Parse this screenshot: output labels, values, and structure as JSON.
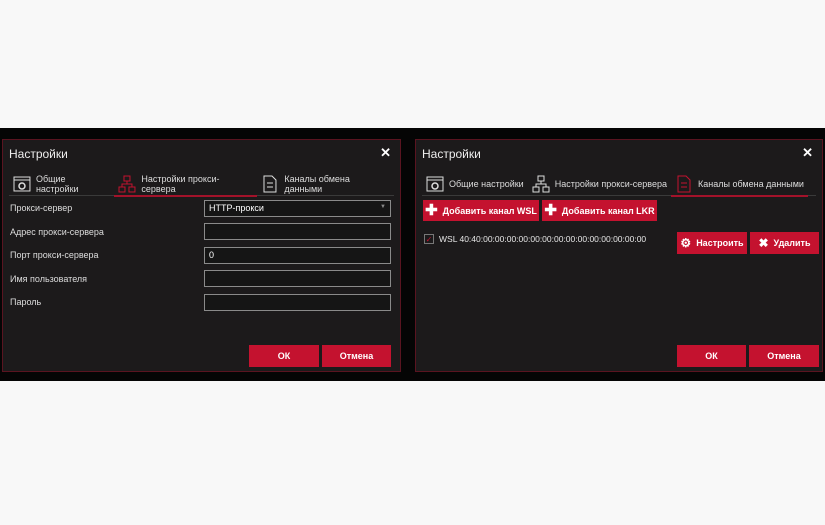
{
  "left": {
    "title": "Настройки",
    "tabs": [
      "Общие настройки",
      "Настройки прокси-сервера",
      "Каналы обмена данными"
    ],
    "fields": [
      {
        "label": "Прокси-сервер",
        "value": "HTTP-прокси"
      },
      {
        "label": "Адрес прокси-сервера",
        "value": ""
      },
      {
        "label": "Порт прокси-сервера",
        "value": "0"
      },
      {
        "label": "Имя пользователя",
        "value": ""
      },
      {
        "label": "Пароль",
        "value": ""
      }
    ],
    "ok": "ОК",
    "cancel": "Отмена"
  },
  "right": {
    "title": "Настройки",
    "tabs": [
      "Общие настройки",
      "Настройки прокси-сервера",
      "Каналы обмена данными"
    ],
    "add_wsl": "Добавить канал WSL",
    "add_lkr": "Добавить канал LKR",
    "channel": "WSL 40:40:00:00:00:00:00:00:00:00:00:00:00:00:00:00",
    "configure": "Настроить",
    "delete": "Удалить",
    "ok": "ОК",
    "cancel": "Отмена"
  },
  "close_glyph": "✕"
}
